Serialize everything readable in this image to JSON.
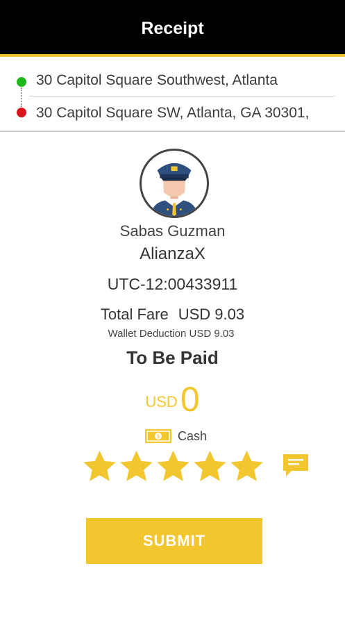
{
  "header": {
    "title": "Receipt"
  },
  "route": {
    "pickup": "30 Capitol Square Southwest, Atlanta",
    "dropoff": "30 Capitol Square SW, Atlanta, GA 30301,"
  },
  "driver": {
    "name": "Sabas Guzman",
    "car_type": "AlianzaX",
    "trip_id": "UTC-12:00433911",
    "avatar_icon": "taxi-driver-avatar-icon"
  },
  "fare": {
    "total_label": "Total Fare",
    "total_value": "USD 9.03",
    "wallet_deduction": "Wallet Deduction USD 9.03",
    "to_be_paid_label": "To Be Paid",
    "due_currency": "USD",
    "due_amount": "0"
  },
  "payment": {
    "method": "Cash",
    "icon": "cash-icon"
  },
  "rating": {
    "stars": 5,
    "max": 5,
    "comment_icon": "comment-icon"
  },
  "actions": {
    "submit_label": "SUBMIT"
  },
  "colors": {
    "accent": "#f2c62f",
    "header_bg": "#000000",
    "pickup_dot": "#1fb81f",
    "dropoff_dot": "#d9141c"
  }
}
